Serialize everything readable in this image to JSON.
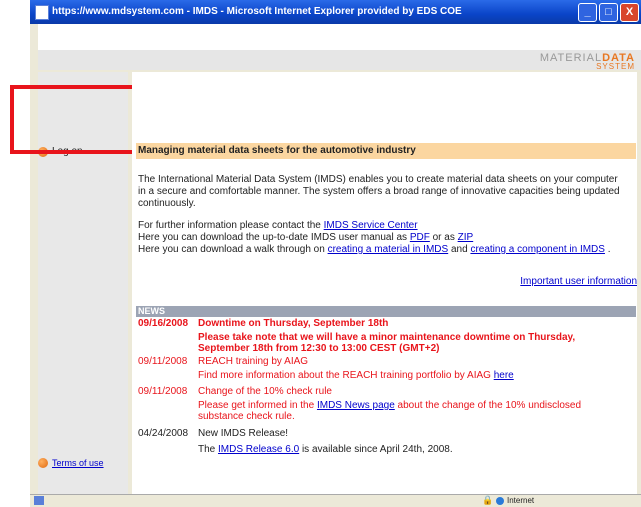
{
  "window": {
    "title": "https://www.mdsystem.com - IMDS - Microsoft Internet Explorer provided by EDS COE",
    "minimize": "_",
    "maximize": "□",
    "close": "X"
  },
  "header": {
    "logo_material": "MATERIAL",
    "logo_data": "DATA",
    "logo_system": "SYSTEM"
  },
  "sidebar": {
    "logon": "Log on",
    "terms": "Terms of use"
  },
  "main": {
    "heading": "Managing material data sheets for the automotive industry",
    "intro": "The International Material Data System (IMDS) enables you to create material data sheets on your computer in a secure and comfortable manner. The system offers a broad range of innovative capacities being updated continuously.",
    "further_prefix": "For further information please contact the ",
    "service_center": "IMDS Service Center",
    "download_prefix": "Here you can download the up-to-date IMDS user manual as ",
    "pdf": "PDF",
    "or_as": " or as ",
    "zip": "ZIP",
    "walk_prefix": "Here you can download a walk through on ",
    "creating_material": "creating a material in IMDS",
    "and": " and ",
    "creating_component": "creating a component in IMDS",
    "walk_suffix": " .",
    "important": "Important user information"
  },
  "news": {
    "header": "NEWS",
    "items": [
      {
        "date": "09/16/2008",
        "title": "Downtime on Thursday, September 18th",
        "body": "Please take note that we will have a minor maintenance downtime on Thursday, September 18th from 12:30 to 13:00 CEST (GMT+2)"
      },
      {
        "date": "09/11/2008",
        "title": "REACH training by AIAG",
        "body_prefix": "Find more information about the REACH training portfolio by AIAG ",
        "link": "here"
      },
      {
        "date": "09/11/2008",
        "title": "Change of the 10% check rule",
        "body_prefix": "Please get informed in the ",
        "link": "IMDS News page",
        "body_suffix": " about the change of the 10% undisclosed substance check rule."
      },
      {
        "date": "04/24/2008",
        "title": "New IMDS Release!",
        "body_prefix": "The ",
        "link": "IMDS Release 6.0",
        "body_suffix": " is available since April 24th, 2008."
      }
    ]
  },
  "statusbar": {
    "zone": "Internet"
  }
}
